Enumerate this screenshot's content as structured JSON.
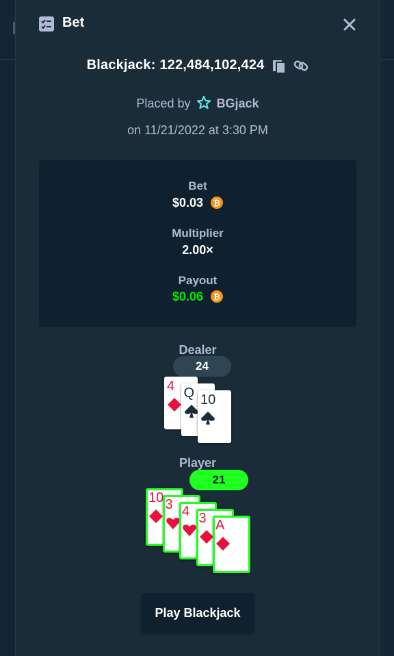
{
  "modal": {
    "title": "Bet",
    "close_icon": "close-icon",
    "bet_icon": "bet-slip-icon"
  },
  "game": {
    "id_text": "Blackjack: 122,484,102,424",
    "copy_icon": "copy-icon",
    "link_icon": "link-icon"
  },
  "placed": {
    "prefix": "Placed by",
    "user_icon": "star-icon",
    "username": "BGjack",
    "date_text": "on 11/21/2022 at 3:30 PM"
  },
  "summary": {
    "bet_label": "Bet",
    "bet_value": "$0.03",
    "multiplier_label": "Multiplier",
    "multiplier_value": "2.00×",
    "payout_label": "Payout",
    "payout_value": "$0.06",
    "currency_icon": "bitcoin-icon"
  },
  "dealer": {
    "label": "Dealer",
    "score": "24",
    "cards": [
      {
        "rank": "4",
        "suit": "diamonds"
      },
      {
        "rank": "Q",
        "suit": "spades"
      },
      {
        "rank": "10",
        "suit": "spades"
      }
    ]
  },
  "player": {
    "label": "Player",
    "score": "21",
    "cards": [
      {
        "rank": "10",
        "suit": "diamonds"
      },
      {
        "rank": "3",
        "suit": "hearts"
      },
      {
        "rank": "4",
        "suit": "hearts"
      },
      {
        "rank": "3",
        "suit": "diamonds"
      },
      {
        "rank": "A",
        "suit": "diamonds"
      }
    ]
  },
  "actions": {
    "play_label": "Play Blackjack"
  },
  "colors": {
    "modal_bg": "#1a2c38",
    "panel_bg": "#0f212e",
    "text_muted": "#b1bad3",
    "win_green": "#1fff20",
    "payout_green": "#00e701",
    "card_red": "#e9113c"
  }
}
